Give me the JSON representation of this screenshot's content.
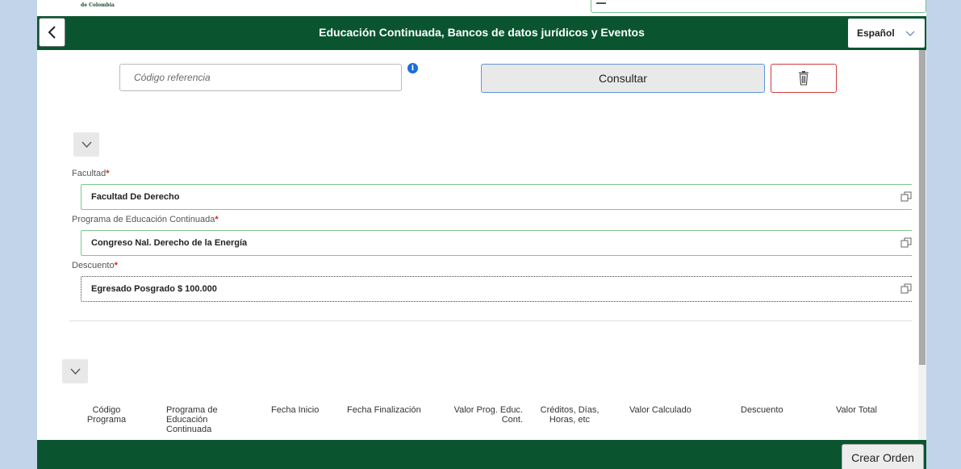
{
  "top_strip": {
    "crest_text": "de Colombia"
  },
  "header": {
    "title": "Educación Continuada, Bancos de datos jurídicos y Eventos"
  },
  "language": {
    "selected": "Español"
  },
  "search": {
    "placeholder": "Código referencia",
    "consultar_label": "Consultar"
  },
  "form": {
    "fields": [
      {
        "label": "Facultad",
        "value": "Facultad De Derecho"
      },
      {
        "label": "Programa de Educación Continuada",
        "value": "Congreso Nal. Derecho de la Energía"
      },
      {
        "label": "Descuento",
        "value": "Egresado Posgrado $ 100.000"
      }
    ],
    "required_marker": "*"
  },
  "table": {
    "columns": [
      "Código Programa",
      "Programa de Educación Continuada",
      "Fecha Inicio",
      "Fecha Finalización",
      "Valor Prog. Educ. Cont.",
      "Créditos, Días, Horas, etc",
      "Valor Calculado",
      "Descuento",
      "Valor Total"
    ]
  },
  "footer": {
    "crear_orden_label": "Crear Orden"
  },
  "colors": {
    "brand_green": "#0a5530",
    "field_border": "#7cc88a",
    "required": "#d9261c",
    "info_blue": "#1a6fd8",
    "delete_red": "#d33a3a"
  },
  "icons": {
    "back": "chevron-left-icon",
    "language": "chevron-down-icon",
    "info": "info-icon",
    "delete": "trash-icon",
    "value_help": "value-help-icon",
    "collapse": "chevron-down-icon"
  }
}
